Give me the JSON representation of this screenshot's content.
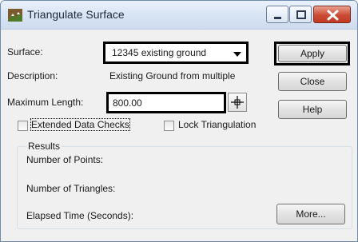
{
  "window": {
    "title": "Triangulate Surface",
    "caption_buttons": {
      "minimize_icon": "minimize-icon",
      "maximize_icon": "maximize-icon",
      "close_icon": "close-icon"
    }
  },
  "form": {
    "surface_label": "Surface:",
    "surface_value": "12345 existing ground",
    "description_label": "Description:",
    "description_value": "Existing Ground from multiple",
    "max_length_label": "Maximum Length:",
    "max_length_value": "800.00",
    "extended_checks_label": "Extended Data Checks",
    "extended_checks_checked": false,
    "lock_triangulation_label": "Lock Triangulation",
    "lock_triangulation_checked": false
  },
  "buttons": {
    "apply": "Apply",
    "close": "Close",
    "help": "Help",
    "more": "More..."
  },
  "results": {
    "group_label": "Results",
    "points_label": "Number of Points:",
    "triangles_label": "Number of Triangles:",
    "elapsed_label": "Elapsed Time (Seconds):"
  },
  "colors": {
    "title_bar": "#d6e3f3",
    "close_button": "#cc4b35",
    "dialog_background": "#f0f0f0"
  }
}
